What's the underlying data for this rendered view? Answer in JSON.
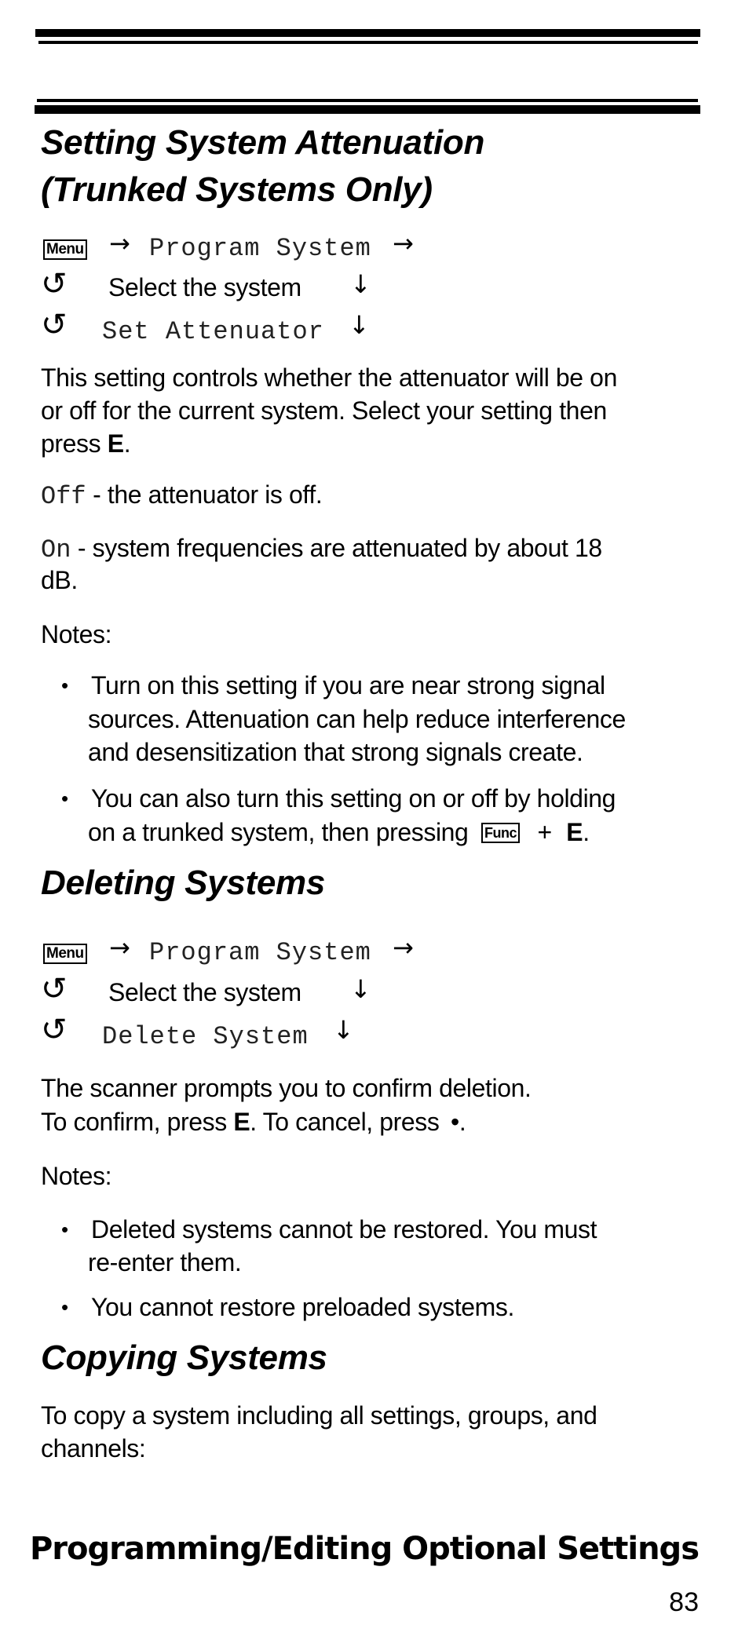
{
  "section_attenuation": {
    "title_line1": "Setting System Attenuation",
    "title_line2": "(Trunked Systems Only)",
    "nav": {
      "menu_key": "Menu",
      "arrow_right": "→",
      "step1": "Program System",
      "step2": "Select the system",
      "step3": "Set Attenuator",
      "arrow_down": "↓",
      "cycle_glyph": "↺"
    },
    "para": {
      "line1": "This setting controls whether the attenuator will be on",
      "line2": "or off for the current system. Select your setting then",
      "line3_pre": "press ",
      "line3_key": "E",
      "line3_post": "."
    },
    "options": [
      {
        "value": "Off",
        "desc": " - the attenuator is off."
      },
      {
        "value": "On",
        "desc_line1": " - system frequencies are attenuated by about 18",
        "desc_line2": "dB."
      }
    ],
    "notes_label": "Notes:",
    "notes": [
      {
        "lines": [
          "Turn on this setting if you are near strong signal",
          "sources. Attenuation can help reduce interference",
          "and desensitization that strong signals create."
        ]
      },
      {
        "line1": "You can also turn this setting on or off by holding",
        "line2_pre": "on a trunked system, then pressing",
        "key": "Func",
        "plus": "+",
        "key2": "E",
        "end": "."
      }
    ]
  },
  "section_deleting": {
    "title": "Deleting Systems",
    "nav": {
      "menu_key": "Menu",
      "step1": "Program System",
      "step2": "Select the system",
      "step3": "Delete System"
    },
    "para": {
      "line1": "The scanner prompts you to confirm deletion.",
      "line2_pre": "To confirm, press ",
      "line2_key": "E",
      "line2_mid": ". To cancel, press ",
      "line2_dot": "•",
      "line2_end": "."
    },
    "notes_label": "Notes:",
    "notes": [
      {
        "lines": [
          "Deleted systems cannot be restored. You must",
          "re-enter them."
        ]
      },
      {
        "lines": [
          "You cannot restore preloaded systems."
        ]
      }
    ]
  },
  "section_copying": {
    "title": "Copying Systems",
    "para_line1": "To copy a system including all settings, groups, and",
    "para_line2": "channels:"
  },
  "footer": {
    "chapter": "Programming/Editing Optional Settings",
    "page_number": "83"
  },
  "bullet_glyph": "•"
}
